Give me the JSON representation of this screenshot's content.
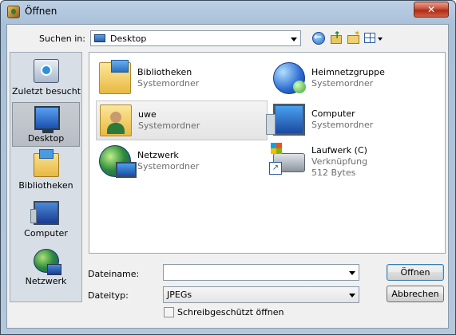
{
  "window": {
    "title": "Öffnen",
    "close_label": "✕"
  },
  "lookin": {
    "label": "Suchen in:",
    "value": "Desktop"
  },
  "toolbar": {
    "back_icon": "back-icon",
    "up_icon": "up-folder-icon",
    "new_folder_icon": "new-folder-icon",
    "views_icon": "views-menu-icon"
  },
  "places": [
    {
      "label": "Zuletzt besucht",
      "icon": "recent-places-icon"
    },
    {
      "label": "Desktop",
      "icon": "desktop-icon",
      "selected": true
    },
    {
      "label": "Bibliotheken",
      "icon": "libraries-icon"
    },
    {
      "label": "Computer",
      "icon": "computer-icon"
    },
    {
      "label": "Netzwerk",
      "icon": "network-icon"
    }
  ],
  "items": [
    {
      "name": "Bibliotheken",
      "type": "Systemordner",
      "icon": "libraries-icon"
    },
    {
      "name": "Heimnetzgruppe",
      "type": "Systemordner",
      "icon": "homegroup-icon"
    },
    {
      "name": "uwe",
      "type": "Systemordner",
      "icon": "user-folder-icon",
      "selected": true
    },
    {
      "name": "Computer",
      "type": "Systemordner",
      "icon": "computer-icon"
    },
    {
      "name": "Netzwerk",
      "type": "Systemordner",
      "icon": "network-icon"
    },
    {
      "name": "Laufwerk (C)",
      "type": "Verknüpfung",
      "size": "512 Bytes",
      "icon": "drive-shortcut-icon"
    }
  ],
  "filename": {
    "label": "Dateiname:",
    "value": ""
  },
  "filetype": {
    "label": "Dateityp:",
    "value": "JPEGs"
  },
  "readonly": {
    "label": "Schreibgeschützt öffnen",
    "checked": false
  },
  "buttons": {
    "open": "Öffnen",
    "cancel": "Abbrechen"
  },
  "colors": {
    "title_gradient_top": "#bcd0e4",
    "close_button": "#c8503a",
    "secondary_text": "#6d6d6d",
    "default_button_border": "#3c7fb1"
  }
}
